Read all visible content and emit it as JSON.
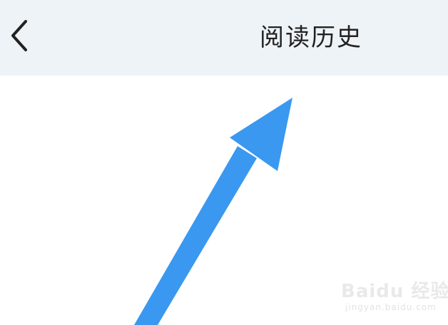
{
  "header": {
    "back_icon": "chevron-left-icon",
    "title": "阅读历史"
  },
  "colors": {
    "nav_background": "#eef3f7",
    "title_text": "#222222",
    "arrow": "#3a98f0",
    "content_background": "#ffffff"
  },
  "watermark": {
    "brand": "Baidu 经验",
    "url": "jingyan.baidu.com"
  }
}
